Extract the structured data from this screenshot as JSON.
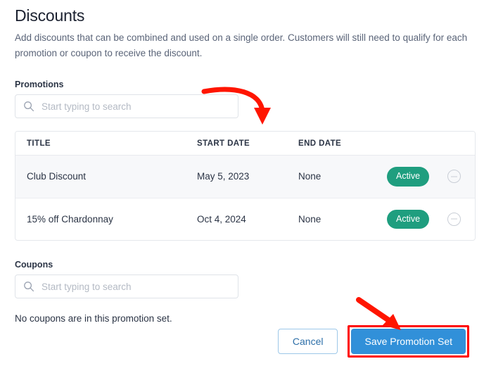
{
  "header": {
    "title": "Discounts",
    "description": "Add discounts that can be combined and used on a single order. Customers will still need to qualify for each promotion or coupon to receive the discount."
  },
  "promotions": {
    "label": "Promotions",
    "search_placeholder": "Start typing to search",
    "search_value": "",
    "search_icon": "search-icon",
    "table": {
      "columns": [
        "TITLE",
        "START DATE",
        "END DATE"
      ],
      "rows": [
        {
          "title": "Club Discount",
          "start_date": "May 5, 2023",
          "end_date": "None",
          "status": "Active",
          "remove_icon": "minus-circle-icon"
        },
        {
          "title": "15% off Chardonnay",
          "start_date": "Oct 4, 2024",
          "end_date": "None",
          "status": "Active",
          "remove_icon": "minus-circle-icon"
        }
      ]
    }
  },
  "coupons": {
    "label": "Coupons",
    "search_placeholder": "Start typing to search",
    "search_value": "",
    "search_icon": "search-icon",
    "empty_message": "No coupons are in this promotion set."
  },
  "footer": {
    "cancel_label": "Cancel",
    "save_label": "Save Promotion Set"
  },
  "annotations": [
    {
      "name": "arrow-to-promotions-table",
      "shape": "curved-arrow-down"
    },
    {
      "name": "arrow-to-save-button",
      "shape": "straight-arrow-down-right"
    },
    {
      "name": "highlight-save-button",
      "shape": "rectangle-outline"
    }
  ],
  "colors": {
    "accent_blue": "#3190d9",
    "cancel_blue": "#2d6fa8",
    "status_green": "#1f9e7f",
    "annotation_red": "#ff0000",
    "text_dark": "#1b2130",
    "text_muted": "#5a6478",
    "row_alt_bg": "#f7f8fa",
    "border": "#e5e8ec"
  }
}
